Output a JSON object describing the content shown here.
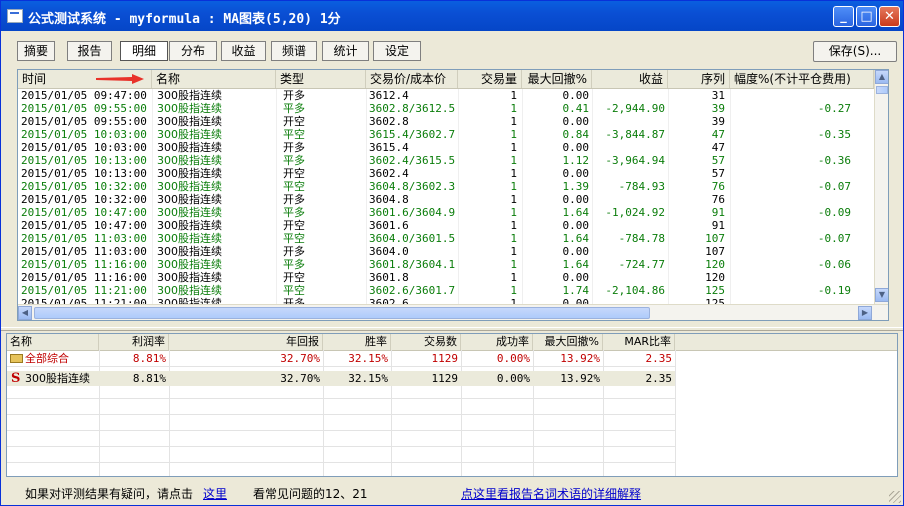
{
  "window": {
    "title": "公式测试系统 - myformula : MA图表(5,20) 1分",
    "minimize_label": "_",
    "maximize_label": "□",
    "close_label": "✕"
  },
  "tabs": [
    {
      "label": "摘要"
    },
    {
      "label": "报告"
    },
    {
      "label": "明细",
      "active": true
    },
    {
      "label": "分布"
    },
    {
      "label": "收益"
    },
    {
      "label": "频谱"
    },
    {
      "label": "统计"
    },
    {
      "label": "设定"
    }
  ],
  "save_button": "保存(S)...",
  "detail": {
    "headers": {
      "time": "时间",
      "name": "名称",
      "type": "类型",
      "price": "交易价/成本价",
      "qty": "交易量",
      "dd": "最大回撤%",
      "pnl": "收益",
      "seq": "序列",
      "pct": "幅度%(不计平仓费用)"
    },
    "rows": [
      {
        "time": "2015/01/05 09:47:00",
        "name": "300股指连续",
        "type": "开多",
        "price": "3612.4",
        "qty": "1",
        "dd": "0.00",
        "pnl": "",
        "seq": "31",
        "pct": "",
        "green": false
      },
      {
        "time": "2015/01/05 09:55:00",
        "name": "300股指连续",
        "type": "平多",
        "price": "3602.8/3612.5",
        "qty": "1",
        "dd": "0.41",
        "pnl": "-2,944.90",
        "seq": "39",
        "pct": "-0.27",
        "green": true
      },
      {
        "time": "2015/01/05 09:55:00",
        "name": "300股指连续",
        "type": "开空",
        "price": "3602.8",
        "qty": "1",
        "dd": "0.00",
        "pnl": "",
        "seq": "39",
        "pct": "",
        "green": false
      },
      {
        "time": "2015/01/05 10:03:00",
        "name": "300股指连续",
        "type": "平空",
        "price": "3615.4/3602.7",
        "qty": "1",
        "dd": "0.84",
        "pnl": "-3,844.87",
        "seq": "47",
        "pct": "-0.35",
        "green": true
      },
      {
        "time": "2015/01/05 10:03:00",
        "name": "300股指连续",
        "type": "开多",
        "price": "3615.4",
        "qty": "1",
        "dd": "0.00",
        "pnl": "",
        "seq": "47",
        "pct": "",
        "green": false
      },
      {
        "time": "2015/01/05 10:13:00",
        "name": "300股指连续",
        "type": "平多",
        "price": "3602.4/3615.5",
        "qty": "1",
        "dd": "1.12",
        "pnl": "-3,964.94",
        "seq": "57",
        "pct": "-0.36",
        "green": true
      },
      {
        "time": "2015/01/05 10:13:00",
        "name": "300股指连续",
        "type": "开空",
        "price": "3602.4",
        "qty": "1",
        "dd": "0.00",
        "pnl": "",
        "seq": "57",
        "pct": "",
        "green": false
      },
      {
        "time": "2015/01/05 10:32:00",
        "name": "300股指连续",
        "type": "平空",
        "price": "3604.8/3602.3",
        "qty": "1",
        "dd": "1.39",
        "pnl": "-784.93",
        "seq": "76",
        "pct": "-0.07",
        "green": true
      },
      {
        "time": "2015/01/05 10:32:00",
        "name": "300股指连续",
        "type": "开多",
        "price": "3604.8",
        "qty": "1",
        "dd": "0.00",
        "pnl": "",
        "seq": "76",
        "pct": "",
        "green": false
      },
      {
        "time": "2015/01/05 10:47:00",
        "name": "300股指连续",
        "type": "平多",
        "price": "3601.6/3604.9",
        "qty": "1",
        "dd": "1.64",
        "pnl": "-1,024.92",
        "seq": "91",
        "pct": "-0.09",
        "green": true
      },
      {
        "time": "2015/01/05 10:47:00",
        "name": "300股指连续",
        "type": "开空",
        "price": "3601.6",
        "qty": "1",
        "dd": "0.00",
        "pnl": "",
        "seq": "91",
        "pct": "",
        "green": false
      },
      {
        "time": "2015/01/05 11:03:00",
        "name": "300股指连续",
        "type": "平空",
        "price": "3604.0/3601.5",
        "qty": "1",
        "dd": "1.64",
        "pnl": "-784.78",
        "seq": "107",
        "pct": "-0.07",
        "green": true
      },
      {
        "time": "2015/01/05 11:03:00",
        "name": "300股指连续",
        "type": "开多",
        "price": "3604.0",
        "qty": "1",
        "dd": "0.00",
        "pnl": "",
        "seq": "107",
        "pct": "",
        "green": false
      },
      {
        "time": "2015/01/05 11:16:00",
        "name": "300股指连续",
        "type": "平多",
        "price": "3601.8/3604.1",
        "qty": "1",
        "dd": "1.64",
        "pnl": "-724.77",
        "seq": "120",
        "pct": "-0.06",
        "green": true
      },
      {
        "time": "2015/01/05 11:16:00",
        "name": "300股指连续",
        "type": "开空",
        "price": "3601.8",
        "qty": "1",
        "dd": "0.00",
        "pnl": "",
        "seq": "120",
        "pct": "",
        "green": false
      },
      {
        "time": "2015/01/05 11:21:00",
        "name": "300股指连续",
        "type": "平空",
        "price": "3602.6/3601.7",
        "qty": "1",
        "dd": "1.74",
        "pnl": "-2,104.86",
        "seq": "125",
        "pct": "-0.19",
        "green": true
      },
      {
        "time": "2015/01/05 11:21:00",
        "name": "300股指连续",
        "type": "开多",
        "price": "3602.6",
        "qty": "1",
        "dd": "0.00",
        "pnl": "",
        "seq": "125",
        "pct": "",
        "green": false
      }
    ]
  },
  "summary": {
    "headers": {
      "name": "名称",
      "profit": "利润率",
      "annual": "年回报",
      "win": "胜率",
      "trades": "交易数",
      "success": "成功率",
      "maxdd": "最大回撤%",
      "mar": "MAR比率"
    },
    "rows": [
      {
        "name": "全部综合",
        "icon": "folder",
        "profit": "8.81%",
        "annual": "32.70%",
        "win": "32.15%",
        "trades": "1129",
        "success": "0.00%",
        "maxdd": "13.92%",
        "mar": "2.35",
        "red": true
      },
      {
        "name": "300股指连续",
        "icon": "strategy",
        "profit": "8.81%",
        "annual": "32.70%",
        "win": "32.15%",
        "trades": "1129",
        "success": "0.00%",
        "maxdd": "13.92%",
        "mar": "2.35",
        "red": false
      }
    ],
    "strategy_icon_glyph": "S"
  },
  "footer": {
    "question_text": "如果对评测结果有疑问，请点击",
    "here_link": "这里",
    "faq_text": "看常见问题的12、21",
    "explain_link": "点这里看报告名词术语的详细解释"
  },
  "colors": {
    "title_bar": "#0a4fd4",
    "trade_close_green": "#0a7d0a",
    "summary_red": "#c00000",
    "link_blue": "#0000cc",
    "arrow_red": "#e8322a"
  },
  "icons": {
    "arrow": "red-arrow-icon",
    "folder": "folder-icon",
    "strategy": "strategy-s-icon"
  }
}
